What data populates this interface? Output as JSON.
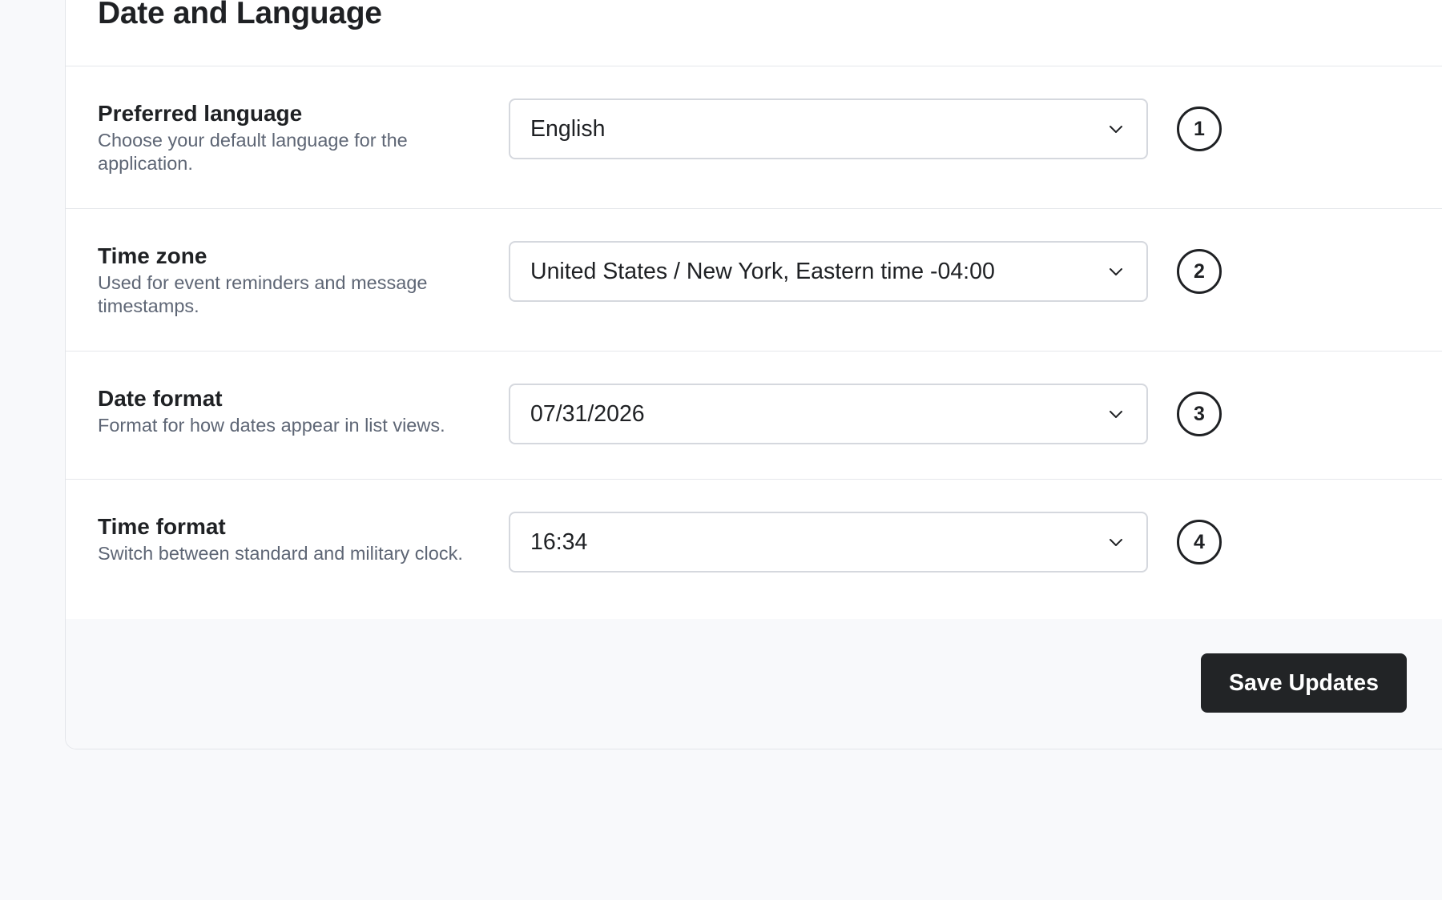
{
  "section": {
    "title": "Date and Language"
  },
  "settings": [
    {
      "title": "Preferred language",
      "description": "Choose your default language for the application.",
      "value": "English",
      "step": "1"
    },
    {
      "title": "Time zone",
      "description": "Used for event reminders and message timestamps.",
      "value": "United States / New York, Eastern time -04:00",
      "step": "2"
    },
    {
      "title": "Date format",
      "description": "Format for how dates appear in list views.",
      "value": "07/31/2026",
      "step": "3"
    },
    {
      "title": "Time format",
      "description": "Switch between standard and military clock.",
      "value": "16:34",
      "step": "4"
    }
  ],
  "footer": {
    "save_label": "Save Updates"
  },
  "icons": {
    "select": "chevron-down-icon"
  },
  "colors": {
    "primary_button": "#222426",
    "page_background": "#f8f9fb",
    "card_background": "#ffffff",
    "muted_text": "#5e6675",
    "border": "#d5d8de"
  }
}
